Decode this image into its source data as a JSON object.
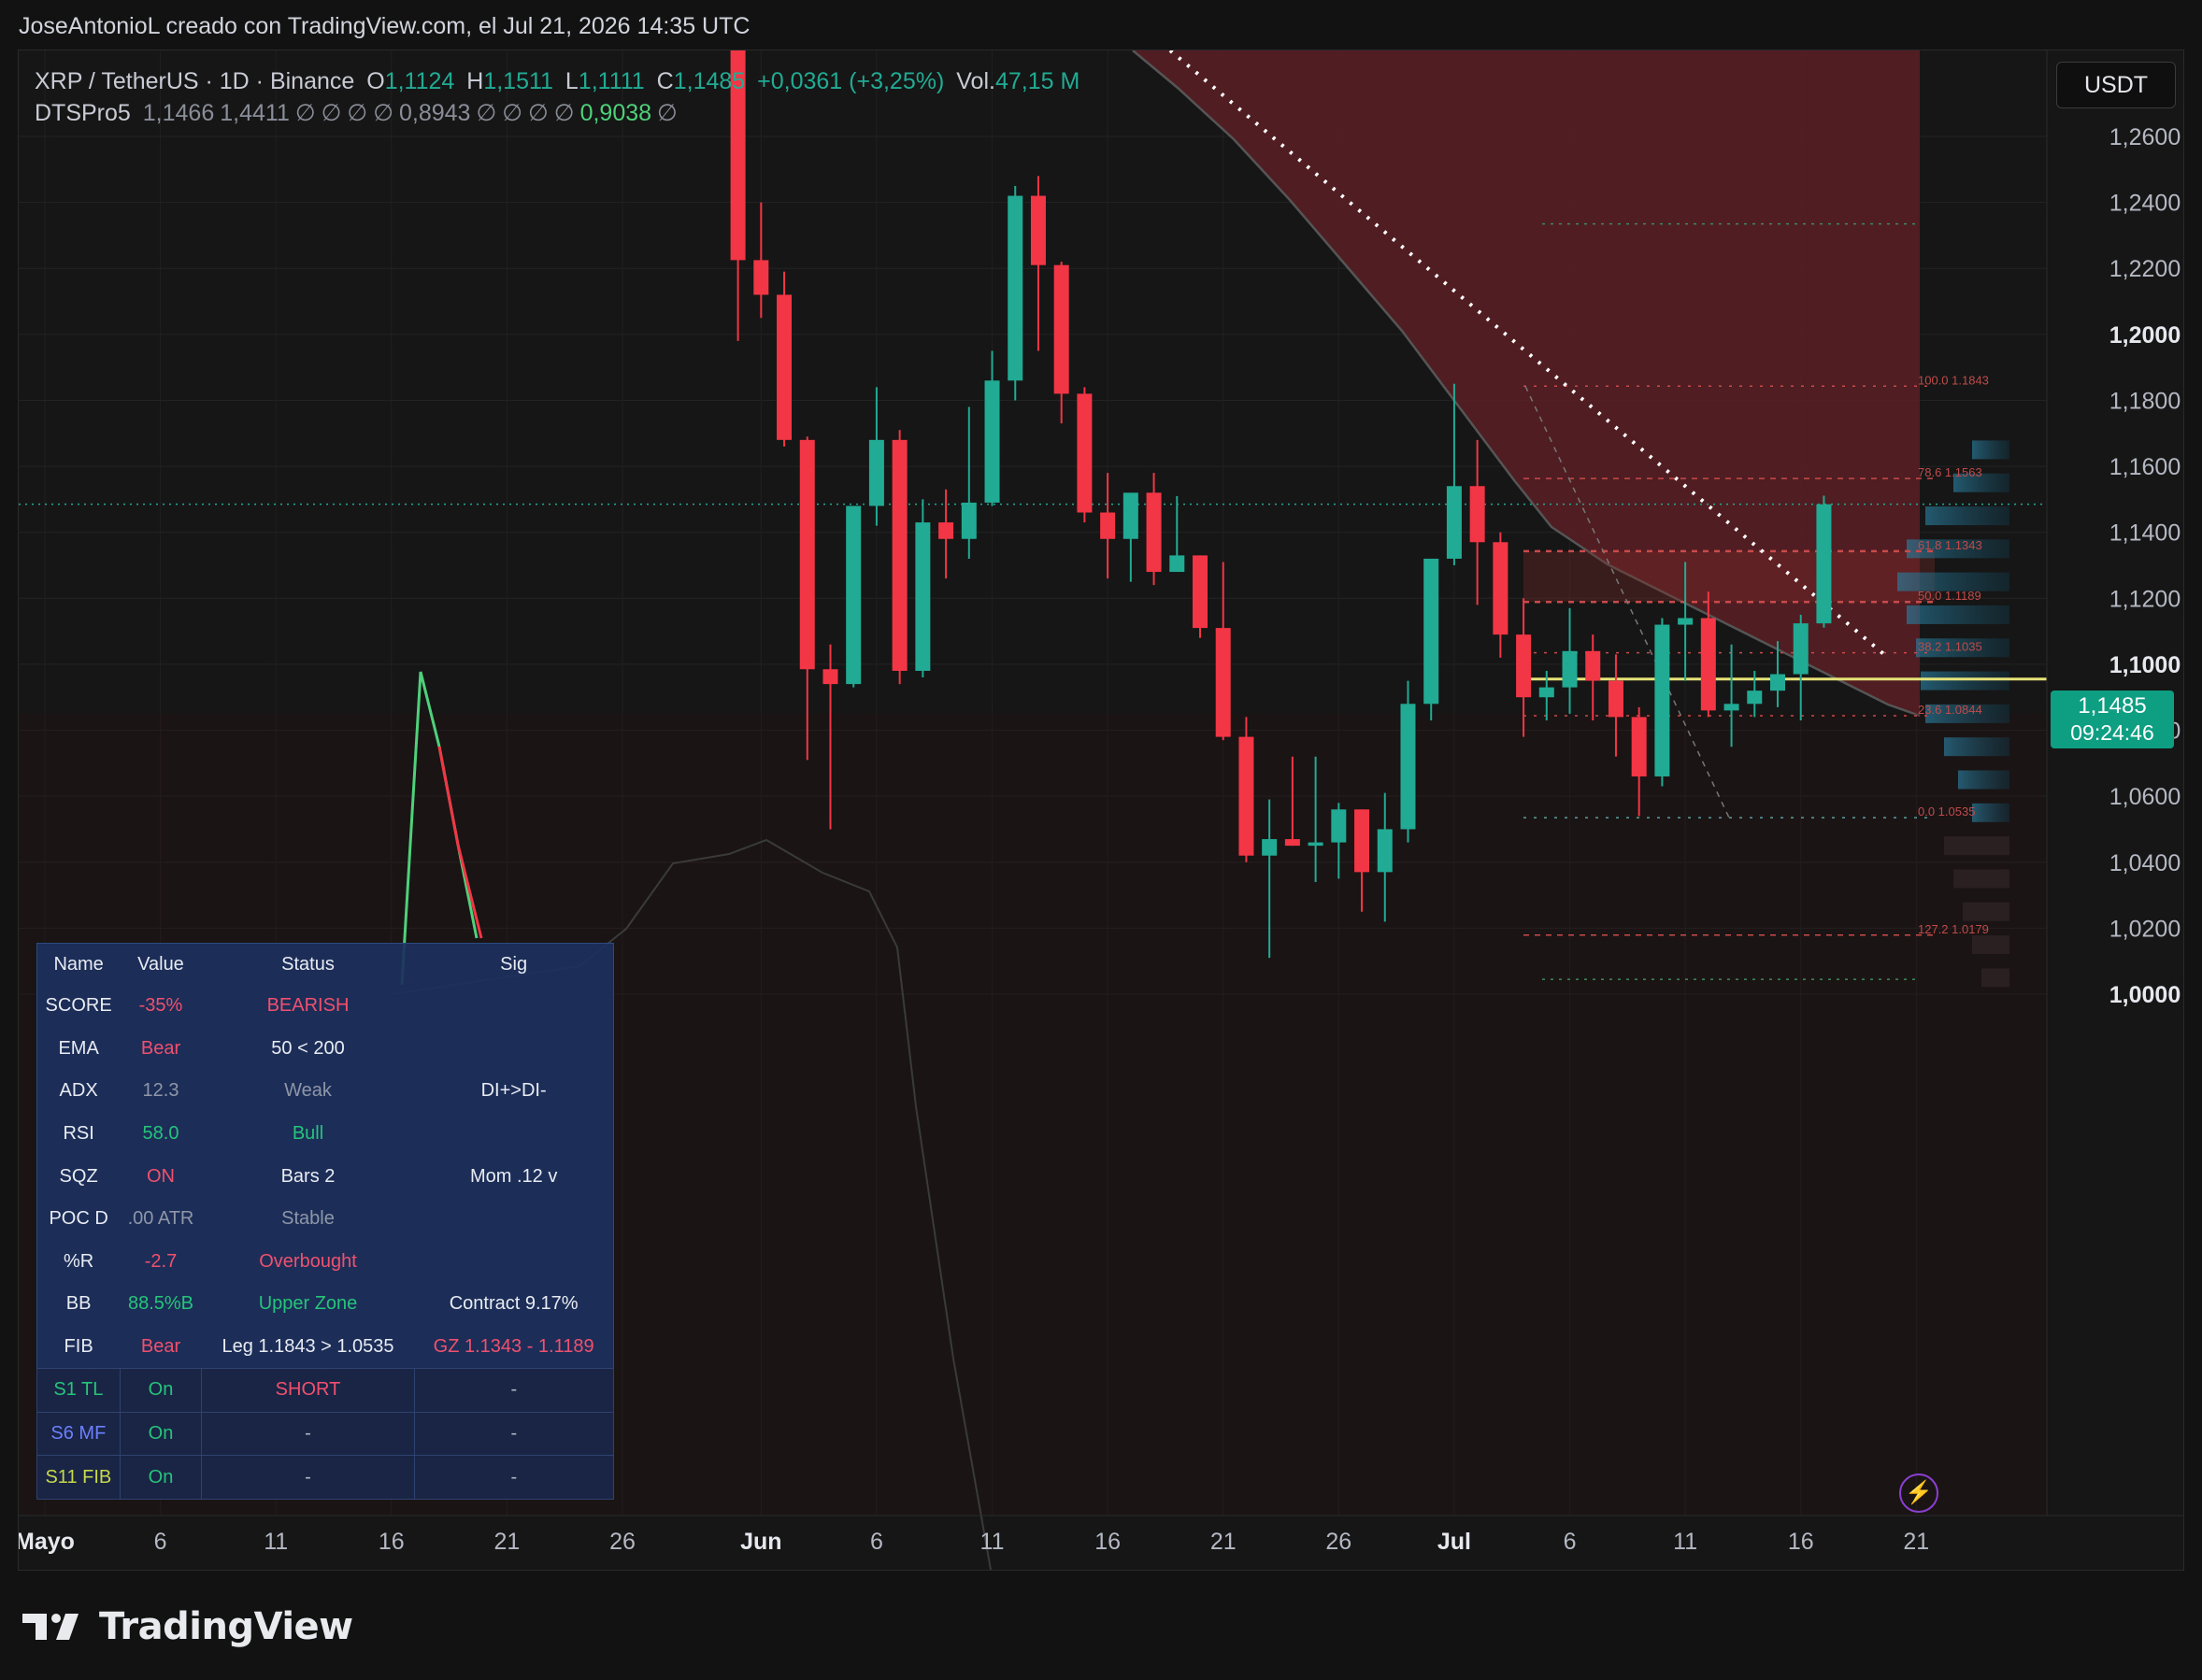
{
  "header": {
    "title": "JoseAntonioL creado con TradingView.com, el Jul 21, 2026 14:35 UTC"
  },
  "legend": {
    "symbol": "XRP / TetherUS · 1D · Binance",
    "o_label": "O",
    "o_value": "1,1124",
    "h_label": "H",
    "h_value": "1,1511",
    "l_label": "L",
    "l_value": "1,1111",
    "c_label": "C",
    "c_value": "1,1485",
    "change": "+0,0361 (+3,25%)",
    "vol_label": "Vol.",
    "vol_value": "47,15 M",
    "indicator_name": "DTSPro5",
    "indicator_values": [
      "1,1466",
      "1,4411",
      "∅",
      "∅",
      "∅",
      "∅",
      "0,8943",
      "∅",
      "∅",
      "∅",
      "∅",
      "0,9038",
      "∅"
    ]
  },
  "toolbar": {
    "currency": "USDT"
  },
  "price_badge": {
    "price": "1,1485",
    "countdown": "09:24:46"
  },
  "y_axis": {
    "labels": [
      "1,2600",
      "1,2400",
      "1,2200",
      "1,2000",
      "1,1800",
      "1,1600",
      "1,1400",
      "1,1200",
      "1,1000",
      "1,0800",
      "1,0600",
      "1,0400",
      "1,0200",
      "1,0000"
    ],
    "bold_labels": [
      "1,2000",
      "1,1000",
      "1,0000"
    ]
  },
  "x_axis": {
    "labels": [
      "Mayo",
      "6",
      "11",
      "16",
      "21",
      "26",
      "Jun",
      "6",
      "11",
      "16",
      "21",
      "26",
      "Jul",
      "6",
      "11",
      "16",
      "21"
    ],
    "bold_labels": [
      "Mayo",
      "Jun",
      "Jul"
    ]
  },
  "fib_labels": [
    "100.0 1.1843",
    "78.6 1.1563",
    "61.8 1.1343",
    "50.0 1.1189",
    "38.2 1.1035",
    "23.6 1.0844",
    "0.0 1.0535",
    "127.2 1.0179"
  ],
  "table": {
    "headers": [
      "Name",
      "Value",
      "Status",
      "Sig"
    ],
    "rows": [
      {
        "name": "SCORE",
        "value": "-35%",
        "status": "BEARISH",
        "sig": ""
      },
      {
        "name": "EMA",
        "value": "Bear",
        "status": "50 < 200",
        "sig": ""
      },
      {
        "name": "ADX",
        "value": "12.3",
        "status": "Weak",
        "sig": "DI+>DI-"
      },
      {
        "name": "RSI",
        "value": "58.0",
        "status": "Bull",
        "sig": ""
      },
      {
        "name": "SQZ",
        "value": "ON",
        "status": "Bars 2",
        "sig": "Mom .12 v"
      },
      {
        "name": "POC D",
        "value": ".00 ATR",
        "status": "Stable",
        "sig": ""
      },
      {
        "name": "%R",
        "value": "-2.7",
        "status": "Overbought",
        "sig": ""
      },
      {
        "name": "BB",
        "value": "88.5%B",
        "status": "Upper Zone",
        "sig": "Contract 9.17%"
      },
      {
        "name": "FIB",
        "value": "Bear",
        "status": "Leg 1.1843 > 1.0535",
        "sig": "GZ 1.1343 - 1.1189"
      }
    ],
    "strategies": [
      {
        "name": "S1 TL",
        "value": "On",
        "status": "SHORT",
        "sig": "-"
      },
      {
        "name": "S6 MF",
        "value": "On",
        "status": "-",
        "sig": "-"
      },
      {
        "name": "S11 FIB",
        "value": "On",
        "status": "-",
        "sig": "-"
      }
    ]
  },
  "footer": {
    "brand": "TradingView"
  },
  "colors": {
    "up": "#22ab94",
    "down": "#f23645",
    "bg": "#121212",
    "bear_zone": "#5a1f25",
    "fib_red": "#e0323c",
    "poc_yellow": "#e6e27a"
  },
  "chart_data": {
    "type": "candlestick",
    "symbol": "XRP / TetherUS",
    "timeframe": "1D",
    "ylim": [
      0.985,
      1.27
    ],
    "candles": [
      {
        "o": 1.29,
        "h": 1.3,
        "l": 1.198,
        "c": 1.2225
      },
      {
        "o": 1.2225,
        "h": 1.24,
        "l": 1.205,
        "c": 1.212
      },
      {
        "o": 1.212,
        "h": 1.219,
        "l": 1.166,
        "c": 1.168
      },
      {
        "o": 1.168,
        "h": 1.169,
        "l": 1.071,
        "c": 1.0985
      },
      {
        "o": 1.0985,
        "h": 1.106,
        "l": 1.05,
        "c": 1.094
      },
      {
        "o": 1.094,
        "h": 1.148,
        "l": 1.093,
        "c": 1.148
      },
      {
        "o": 1.148,
        "h": 1.184,
        "l": 1.142,
        "c": 1.168
      },
      {
        "o": 1.168,
        "h": 1.171,
        "l": 1.094,
        "c": 1.098
      },
      {
        "o": 1.098,
        "h": 1.15,
        "l": 1.096,
        "c": 1.143
      },
      {
        "o": 1.143,
        "h": 1.153,
        "l": 1.126,
        "c": 1.138
      },
      {
        "o": 1.138,
        "h": 1.178,
        "l": 1.132,
        "c": 1.149
      },
      {
        "o": 1.149,
        "h": 1.195,
        "l": 1.148,
        "c": 1.186
      },
      {
        "o": 1.186,
        "h": 1.245,
        "l": 1.18,
        "c": 1.242
      },
      {
        "o": 1.242,
        "h": 1.248,
        "l": 1.195,
        "c": 1.221
      },
      {
        "o": 1.221,
        "h": 1.222,
        "l": 1.173,
        "c": 1.182
      },
      {
        "o": 1.182,
        "h": 1.184,
        "l": 1.143,
        "c": 1.146
      },
      {
        "o": 1.146,
        "h": 1.158,
        "l": 1.126,
        "c": 1.138
      },
      {
        "o": 1.138,
        "h": 1.149,
        "l": 1.125,
        "c": 1.152
      },
      {
        "o": 1.152,
        "h": 1.158,
        "l": 1.124,
        "c": 1.128
      },
      {
        "o": 1.128,
        "h": 1.151,
        "l": 1.128,
        "c": 1.133
      },
      {
        "o": 1.133,
        "h": 1.133,
        "l": 1.108,
        "c": 1.111
      },
      {
        "o": 1.111,
        "h": 1.131,
        "l": 1.077,
        "c": 1.078
      },
      {
        "o": 1.078,
        "h": 1.084,
        "l": 1.04,
        "c": 1.042
      },
      {
        "o": 1.042,
        "h": 1.059,
        "l": 1.011,
        "c": 1.047
      },
      {
        "o": 1.047,
        "h": 1.072,
        "l": 1.045,
        "c": 1.045
      },
      {
        "o": 1.045,
        "h": 1.072,
        "l": 1.034,
        "c": 1.046
      },
      {
        "o": 1.046,
        "h": 1.058,
        "l": 1.035,
        "c": 1.056
      },
      {
        "o": 1.056,
        "h": 1.056,
        "l": 1.025,
        "c": 1.037
      },
      {
        "o": 1.037,
        "h": 1.061,
        "l": 1.022,
        "c": 1.05
      },
      {
        "o": 1.05,
        "h": 1.095,
        "l": 1.046,
        "c": 1.088
      },
      {
        "o": 1.088,
        "h": 1.124,
        "l": 1.083,
        "c": 1.132
      },
      {
        "o": 1.132,
        "h": 1.185,
        "l": 1.13,
        "c": 1.154
      },
      {
        "o": 1.154,
        "h": 1.168,
        "l": 1.118,
        "c": 1.137
      },
      {
        "o": 1.137,
        "h": 1.14,
        "l": 1.102,
        "c": 1.109
      },
      {
        "o": 1.109,
        "h": 1.12,
        "l": 1.078,
        "c": 1.09
      },
      {
        "o": 1.09,
        "h": 1.098,
        "l": 1.083,
        "c": 1.093
      },
      {
        "o": 1.093,
        "h": 1.117,
        "l": 1.085,
        "c": 1.104
      },
      {
        "o": 1.104,
        "h": 1.109,
        "l": 1.083,
        "c": 1.095
      },
      {
        "o": 1.095,
        "h": 1.103,
        "l": 1.072,
        "c": 1.084
      },
      {
        "o": 1.084,
        "h": 1.087,
        "l": 1.054,
        "c": 1.066
      },
      {
        "o": 1.066,
        "h": 1.114,
        "l": 1.063,
        "c": 1.112
      },
      {
        "o": 1.112,
        "h": 1.131,
        "l": 1.095,
        "c": 1.114
      },
      {
        "o": 1.114,
        "h": 1.122,
        "l": 1.084,
        "c": 1.086
      },
      {
        "o": 1.086,
        "h": 1.106,
        "l": 1.075,
        "c": 1.088
      },
      {
        "o": 1.088,
        "h": 1.098,
        "l": 1.084,
        "c": 1.092
      },
      {
        "o": 1.092,
        "h": 1.107,
        "l": 1.087,
        "c": 1.097
      },
      {
        "o": 1.097,
        "h": 1.115,
        "l": 1.083,
        "c": 1.1124
      },
      {
        "o": 1.1124,
        "h": 1.1511,
        "l": 1.1111,
        "c": 1.1485
      }
    ],
    "fib_levels": [
      {
        "ratio": "100.0",
        "price": 1.1843
      },
      {
        "ratio": "78.6",
        "price": 1.1563
      },
      {
        "ratio": "61.8",
        "price": 1.1343
      },
      {
        "ratio": "50.0",
        "price": 1.1189
      },
      {
        "ratio": "38.2",
        "price": 1.1035
      },
      {
        "ratio": "23.6",
        "price": 1.0844
      },
      {
        "ratio": "0.0",
        "price": 1.0535
      },
      {
        "ratio": "127.2",
        "price": 1.0179
      }
    ],
    "poc_price": 1.0955,
    "last_price": 1.1485
  }
}
